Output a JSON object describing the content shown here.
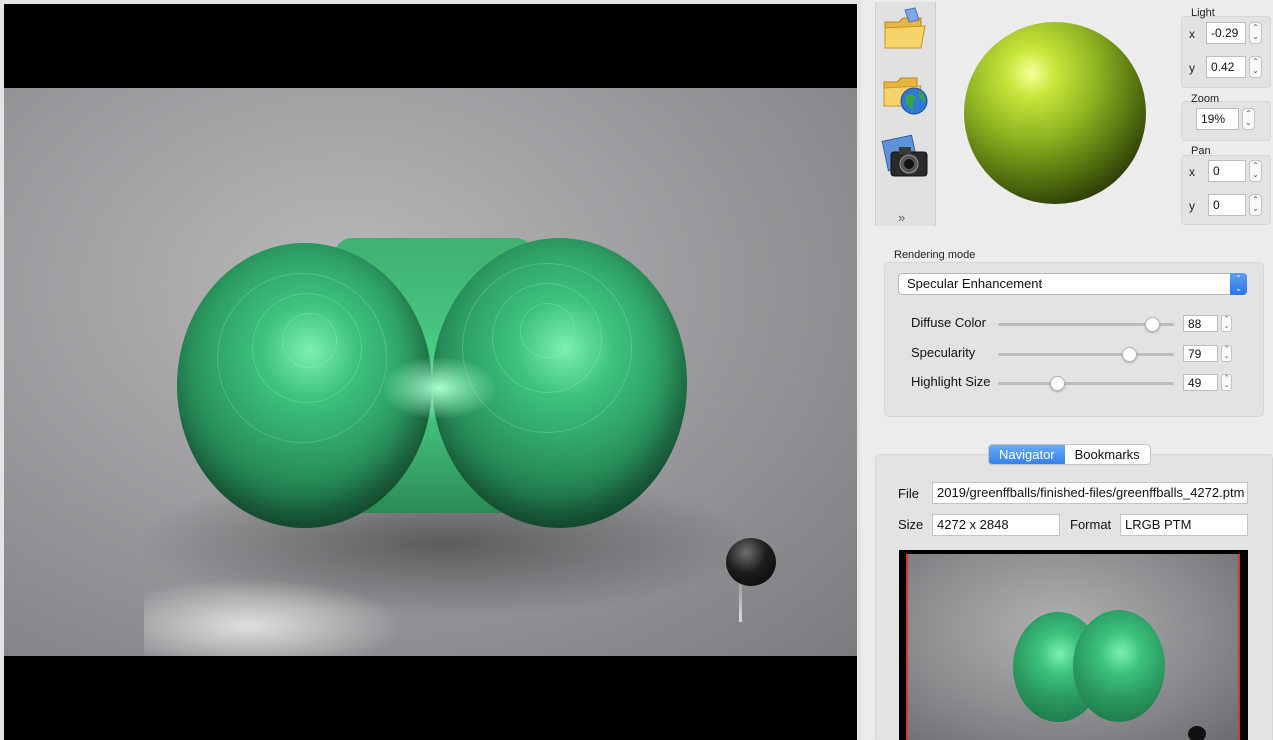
{
  "viewer": {
    "scene": "photo of two green spheres joined by a block on a white surface with a black pin"
  },
  "toolbar": {
    "tools": [
      {
        "name": "open-file-icon"
      },
      {
        "name": "open-url-icon"
      },
      {
        "name": "snapshot-icon"
      }
    ],
    "more": "»"
  },
  "light": {
    "label": "Light",
    "x_label": "x",
    "x_value": "-0.29",
    "y_label": "y",
    "y_value": "0.42"
  },
  "zoom": {
    "label": "Zoom",
    "value": "19%"
  },
  "pan": {
    "label": "Pan",
    "x_label": "x",
    "x_value": "0",
    "y_label": "y",
    "y_value": "0"
  },
  "rendering": {
    "label": "Rendering mode",
    "mode": "Specular Enhancement",
    "sliders": [
      {
        "label": "Diffuse Color",
        "value": "88",
        "fraction": 0.88
      },
      {
        "label": "Specularity",
        "value": "79",
        "fraction": 0.75
      },
      {
        "label": "Highlight Size",
        "value": "49",
        "fraction": 0.34
      }
    ]
  },
  "tabs": {
    "navigator": "Navigator",
    "bookmarks": "Bookmarks"
  },
  "info": {
    "file_label": "File",
    "file_value": "2019/greenffballs/finished-files/greenffballs_4272.ptm",
    "size_label": "Size",
    "size_value": "4272 x 2848",
    "format_label": "Format",
    "format_value": "LRGB PTM"
  },
  "colors": {
    "accent": "#3682ee",
    "viewport_rect": "#e0332b"
  }
}
